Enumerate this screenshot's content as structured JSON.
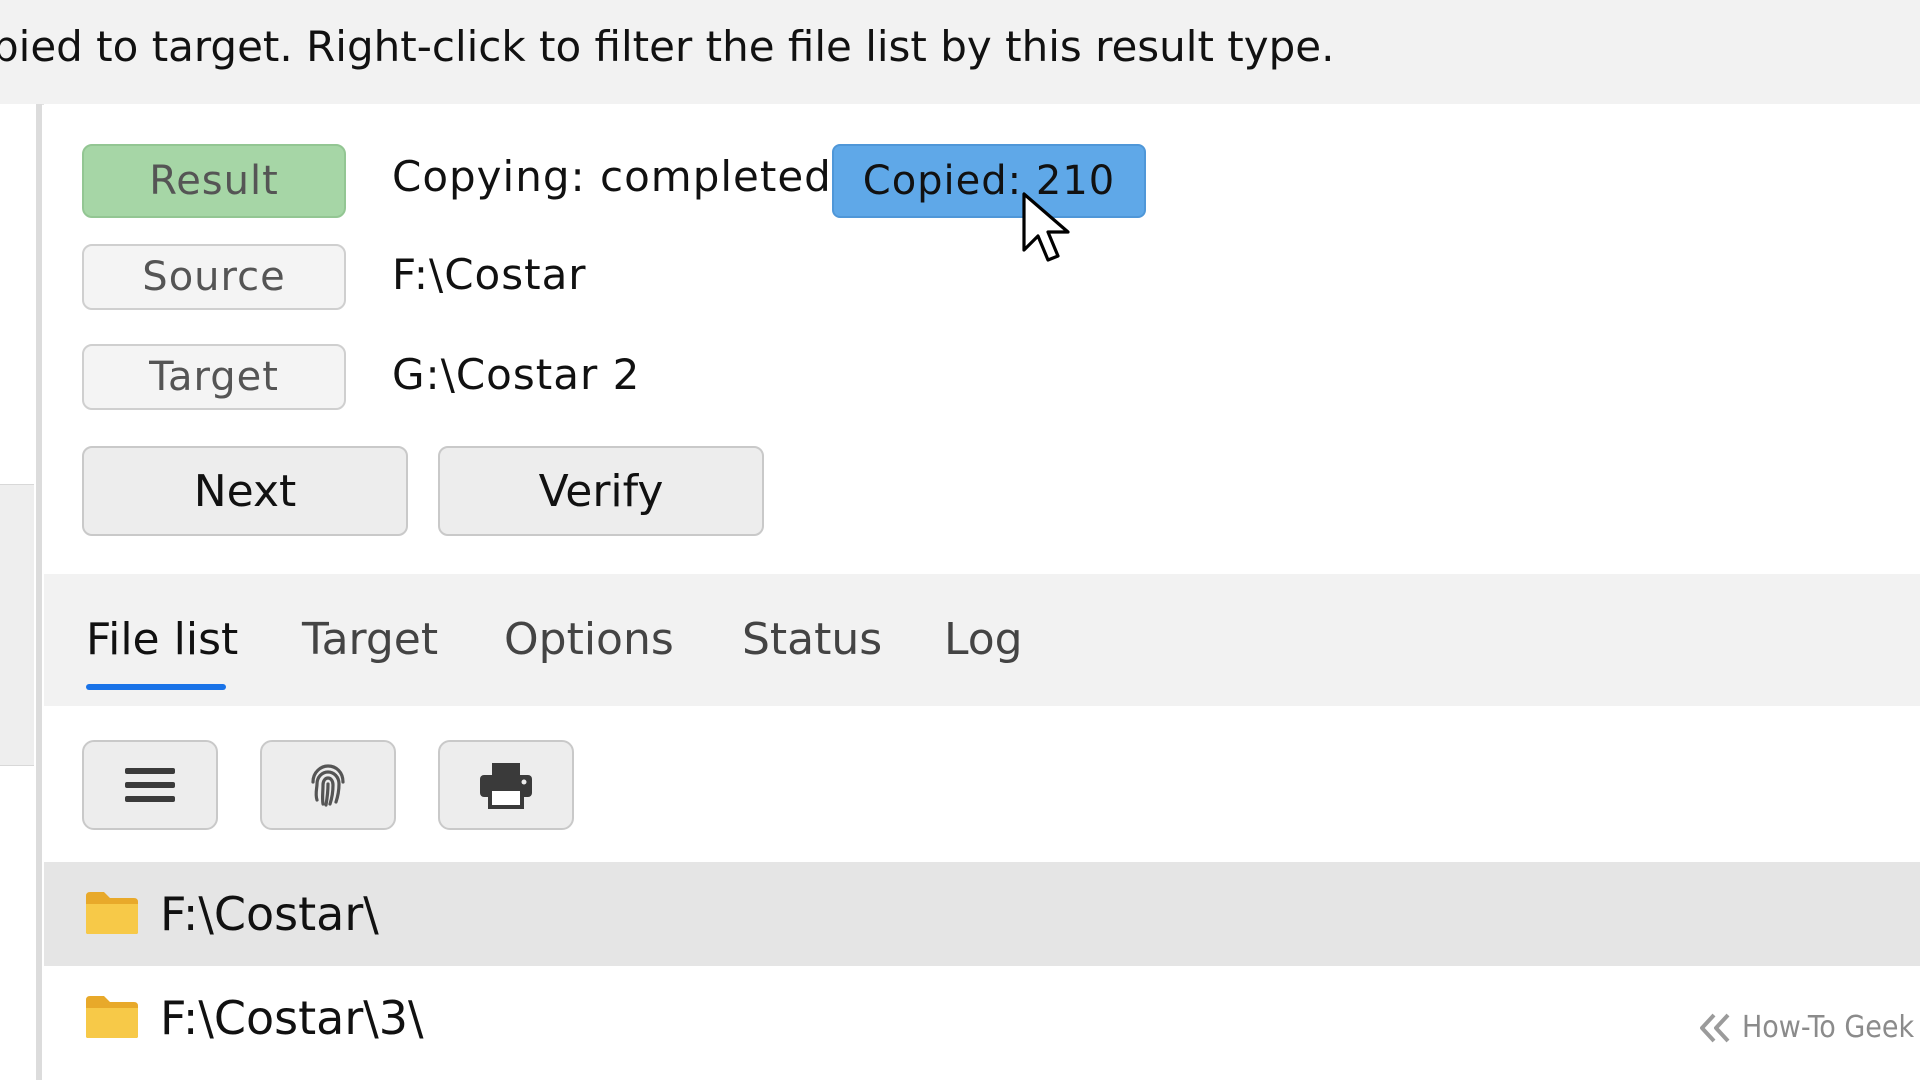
{
  "tooltip": {
    "text": "pied to target. Right-click to filter the file list by this result type."
  },
  "summary": {
    "result_label": "Result",
    "result_value": "Copying: completed",
    "copied_label": "Copied: 210",
    "source_label": "Source",
    "source_value": "F:\\Costar",
    "target_label": "Target",
    "target_value": "G:\\Costar 2"
  },
  "actions": {
    "next_label": "Next",
    "verify_label": "Verify"
  },
  "tabs": [
    {
      "label": "File list",
      "active": true
    },
    {
      "label": "Target",
      "active": false
    },
    {
      "label": "Options",
      "active": false
    },
    {
      "label": "Status",
      "active": false
    },
    {
      "label": "Log",
      "active": false
    }
  ],
  "toolbar": {
    "icons": [
      "menu-icon",
      "fingerprint-icon",
      "printer-icon"
    ]
  },
  "file_list": [
    {
      "path": "F:\\Costar\\",
      "selected": true
    },
    {
      "path": "F:\\Costar\\3\\",
      "selected": false
    }
  ],
  "colors": {
    "result_badge": "#a6d6a6",
    "copied_badge": "#5fa8e8",
    "tab_accent": "#1a73e8",
    "folder": "#f7c948"
  },
  "watermark": {
    "text": "How-To Geek"
  }
}
